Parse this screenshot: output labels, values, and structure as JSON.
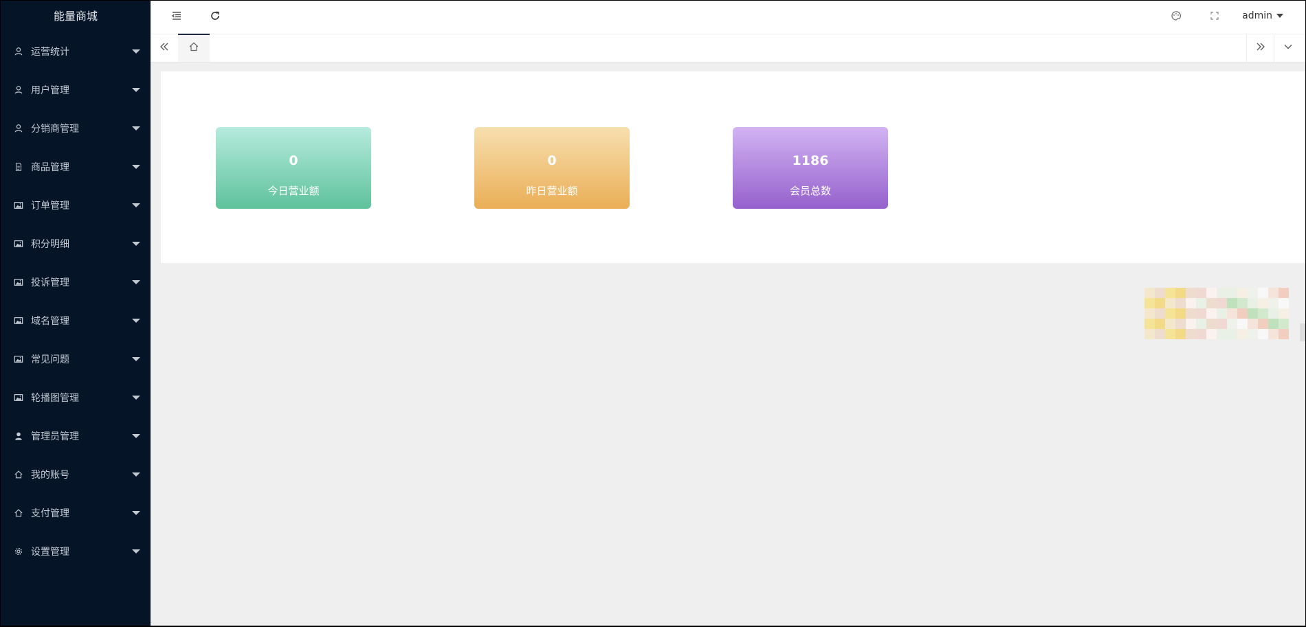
{
  "sidebar": {
    "logo": "能量商城",
    "items": [
      {
        "label": "运营统计",
        "icon": "user-icon"
      },
      {
        "label": "用户管理",
        "icon": "user-icon"
      },
      {
        "label": "分销商管理",
        "icon": "user-icon"
      },
      {
        "label": "商品管理",
        "icon": "file-icon"
      },
      {
        "label": "订单管理",
        "icon": "image-icon"
      },
      {
        "label": "积分明细",
        "icon": "image-icon"
      },
      {
        "label": "投诉管理",
        "icon": "image-icon"
      },
      {
        "label": "域名管理",
        "icon": "image-icon"
      },
      {
        "label": "常见问题",
        "icon": "image-icon"
      },
      {
        "label": "轮播图管理",
        "icon": "image-icon"
      },
      {
        "label": "管理员管理",
        "icon": "user-solid-icon"
      },
      {
        "label": "我的账号",
        "icon": "home-icon"
      },
      {
        "label": "支付管理",
        "icon": "home-icon"
      },
      {
        "label": "设置管理",
        "icon": "gear-icon"
      }
    ]
  },
  "header": {
    "user": "admin",
    "icons": [
      "menu-fold-icon",
      "refresh-icon",
      "theme-icon",
      "fullscreen-icon"
    ]
  },
  "tabs": {
    "home_icon": "home-icon"
  },
  "stats": [
    {
      "value": "0",
      "label": "今日营业额",
      "color_top": "#b7ebdd",
      "color_bottom": "#5ec29d"
    },
    {
      "value": "0",
      "label": "昨日营业额",
      "color_top": "#f7dfaf",
      "color_bottom": "#eaae56"
    },
    {
      "value": "1186",
      "label": "会员总数",
      "color_top": "#d3b3f3",
      "color_bottom": "#9461cc"
    }
  ],
  "colors": {
    "sidebar_bg": "#051527",
    "content_bg": "#efefef"
  }
}
